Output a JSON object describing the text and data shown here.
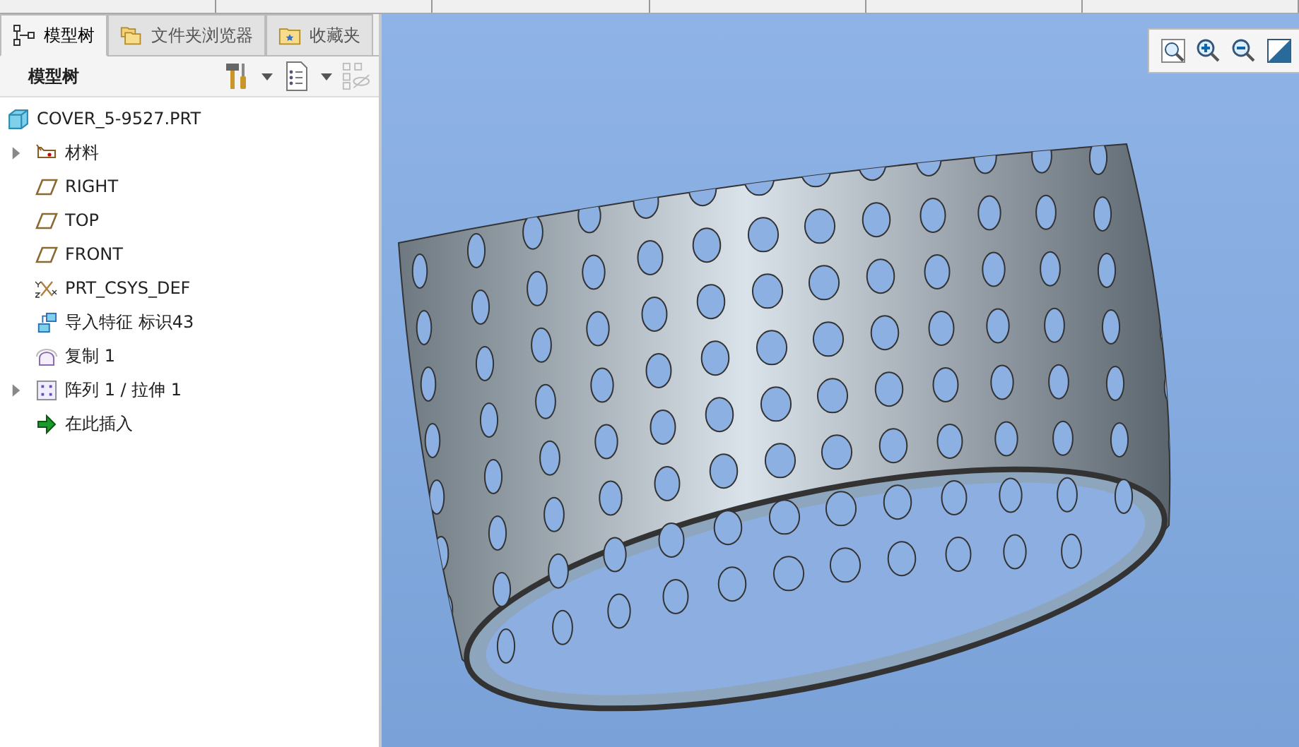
{
  "tabs": [
    {
      "label": "模型树",
      "selected": true
    },
    {
      "label": "文件夹浏览器",
      "selected": false
    },
    {
      "label": "收藏夹",
      "selected": false
    }
  ],
  "panel_header": {
    "title": "模型树"
  },
  "tree": {
    "root": "COVER_5-9527.PRT",
    "items": [
      {
        "label": "材料",
        "kind": "material",
        "expandable": true
      },
      {
        "label": "RIGHT",
        "kind": "plane",
        "expandable": false
      },
      {
        "label": "TOP",
        "kind": "plane",
        "expandable": false
      },
      {
        "label": "FRONT",
        "kind": "plane",
        "expandable": false
      },
      {
        "label": "PRT_CSYS_DEF",
        "kind": "csys",
        "expandable": false
      },
      {
        "label": "导入特征 标识43",
        "kind": "import",
        "expandable": false
      },
      {
        "label": "复制 1",
        "kind": "copy",
        "expandable": false
      },
      {
        "label": "阵列 1 / 拉伸 1",
        "kind": "pattern",
        "expandable": true
      },
      {
        "label": "在此插入",
        "kind": "insert",
        "expandable": false
      }
    ]
  }
}
